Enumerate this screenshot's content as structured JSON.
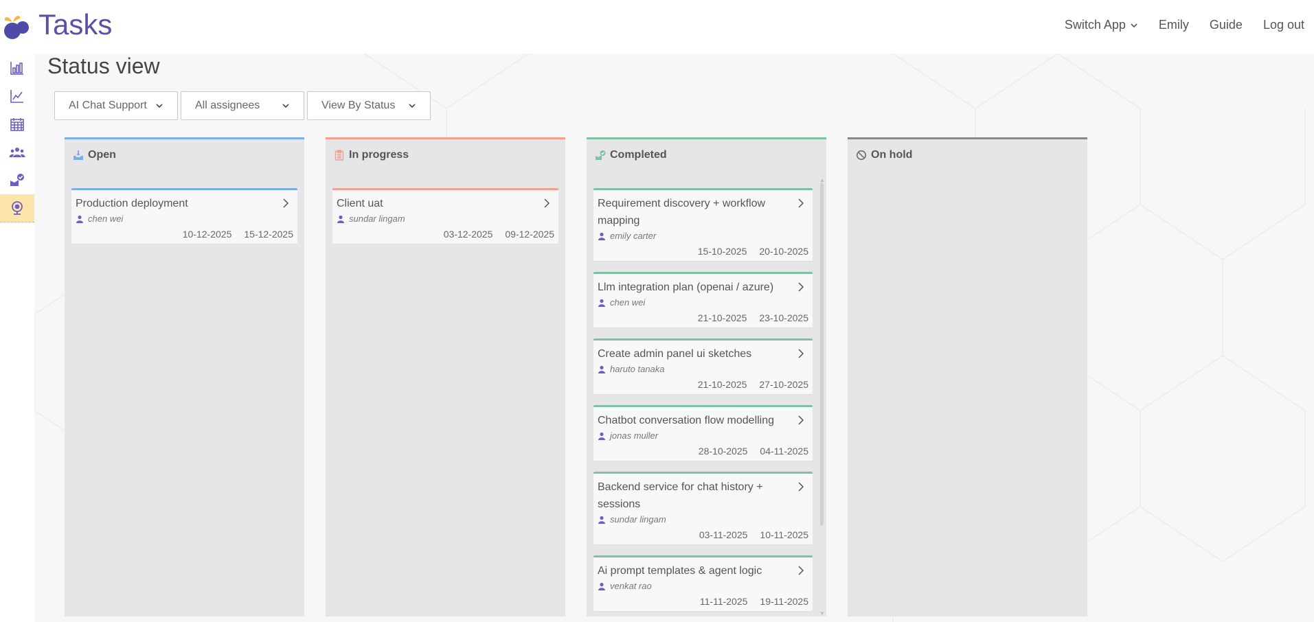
{
  "app": {
    "title": "Tasks"
  },
  "nav": {
    "switch_app": "Switch App",
    "user": "Emily",
    "guide": "Guide",
    "logout": "Log out"
  },
  "sidebar": {
    "items": [
      {
        "icon": "bar-chart-icon"
      },
      {
        "icon": "line-chart-icon"
      },
      {
        "icon": "calendar-icon"
      },
      {
        "icon": "team-icon"
      },
      {
        "icon": "task-check-icon"
      },
      {
        "icon": "webcam-icon",
        "active": true
      }
    ]
  },
  "page": {
    "title": "Status view"
  },
  "filters": {
    "project": "AI Chat Support",
    "assignees": "All assignees",
    "view": "View By Status"
  },
  "colors": {
    "brand": "#5b4fa8",
    "open": "#7aaee8",
    "in_progress": "#f0a08c",
    "completed": "#7cc4a0",
    "on_hold": "#888888",
    "active_sidebar": "#fde4a8",
    "icon": "#6b5fc7"
  },
  "columns": [
    {
      "key": "open",
      "title": "Open",
      "icon": "inbox-download-icon",
      "cards": [
        {
          "title": "Production deployment",
          "assignee": "chen wei",
          "start": "10-12-2025",
          "end": "15-12-2025"
        }
      ]
    },
    {
      "key": "in_progress",
      "title": "In progress",
      "icon": "clipboard-icon",
      "cards": [
        {
          "title": "Client uat",
          "assignee": "sundar lingam",
          "start": "03-12-2025",
          "end": "09-12-2025"
        }
      ]
    },
    {
      "key": "completed",
      "title": "Completed",
      "icon": "completed-check-icon",
      "cards": [
        {
          "title": "Requirement discovery + workflow mapping",
          "assignee": "emily carter",
          "start": "15-10-2025",
          "end": "20-10-2025"
        },
        {
          "title": "Llm integration plan (openai / azure)",
          "assignee": "chen wei",
          "start": "21-10-2025",
          "end": "23-10-2025"
        },
        {
          "title": "Create admin panel ui sketches",
          "assignee": "haruto tanaka",
          "start": "21-10-2025",
          "end": "27-10-2025"
        },
        {
          "title": "Chatbot conversation flow modelling",
          "assignee": "jonas muller",
          "start": "28-10-2025",
          "end": "04-11-2025"
        },
        {
          "title": "Backend service for chat history + sessions",
          "assignee": "sundar lingam",
          "start": "03-11-2025",
          "end": "10-11-2025"
        },
        {
          "title": "Ai prompt templates & agent logic",
          "assignee": "venkat rao",
          "start": "11-11-2025",
          "end": "19-11-2025"
        }
      ]
    },
    {
      "key": "on_hold",
      "title": "On hold",
      "icon": "blocked-icon",
      "cards": []
    }
  ]
}
